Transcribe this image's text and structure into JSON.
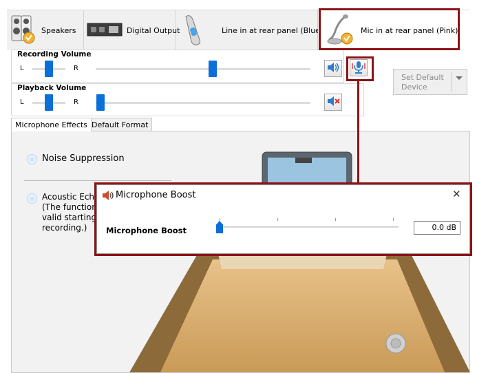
{
  "devices": [
    {
      "label": "Speakers",
      "icon": "speakers-icon"
    },
    {
      "label": "Digital Output",
      "icon": "digital-output-icon"
    },
    {
      "label": "Line in at rear panel (Blue)",
      "icon": "line-in-icon"
    },
    {
      "label": "Mic in at rear panel (Pink)",
      "icon": "microphone-icon",
      "active": true
    }
  ],
  "recording": {
    "title": "Recording Volume",
    "left": "L",
    "right": "R"
  },
  "playback": {
    "title": "Playback Volume",
    "left": "L",
    "right": "R"
  },
  "set_default": {
    "line1": "Set Default",
    "line2": "Device"
  },
  "tabs": [
    {
      "label": "Microphone Effects",
      "active": true
    },
    {
      "label": "Default Format",
      "active": false
    }
  ],
  "effects": {
    "noise_suppression": "Noise Suppression",
    "acoustic_line1": "Acoustic Ech",
    "acoustic_line2": "(The function",
    "acoustic_line3": "valid starting",
    "acoustic_line4": "recording.)"
  },
  "boost_dialog": {
    "title": "Microphone Boost",
    "label": "Microphone Boost",
    "value": "0.0 dB",
    "close": "✕"
  },
  "colors": {
    "accent": "#0a6fd8",
    "highlight": "#8b1316"
  }
}
